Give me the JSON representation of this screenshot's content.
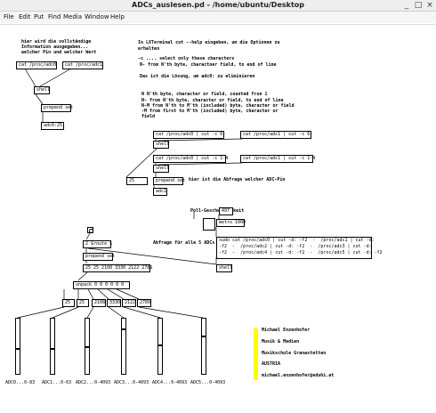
{
  "window": {
    "title": "ADCs_auslesen.pd  - /home/ubuntu/Desktop",
    "minimize": "_",
    "maximize": "□",
    "close": "×"
  },
  "menu": [
    "File",
    "Edit",
    "Put",
    "Find",
    "Media",
    "Window",
    "Help"
  ],
  "comments": {
    "intro": [
      "hier wird die vollständige",
      "Information ausgegeben...",
      "welcher Pin und welcher Wert"
    ],
    "help": [
      "In LXTerminal  cut --help  eingeben, um die Optionen zu",
      "erhalten"
    ],
    "opt1": "-c  .... select only these characters",
    "opt2": "N-    from N'th byte, charactoer field, to end of line",
    "opt3": "Das ist die Lösung, um adc0:  zu eliminieren",
    "opt4": "N     N'th byte, character or field, counted fron 1",
    "opt5": "N-    from N'th byte, character or field, to end of line",
    "opt6": "N-M   from N'th to M'th (included) byte, character or field",
    "opt7": "-M    from first to M'th (included) byte, character or",
    "opt8": "field",
    "pin": "hier ist die Abfrage welcher ADC-Pin",
    "poll": "Poll-Geschwindigkeit",
    "all": "Abfrage für alle 5 ADCs",
    "slider_labels": [
      "ADC0...0-83",
      "ADC1...0-63",
      "ADC2...0-4093",
      "ADC3...0-4093",
      "ADC4...0-4093",
      "ADC5...0-4093"
    ]
  },
  "credits": [
    "Michael Enzenhofer",
    "Musik & Medien",
    "Musikschule Granastetten",
    "AUSTRIA",
    "michael.enzenhofer@eduhi.at"
  ],
  "objects": {
    "cat_adc0": "cat /proc/adc0",
    "cat_adc1": "cat /proc/adc1",
    "shell": "shell",
    "prepend": "prepend set",
    "adc_msg": "adc0:25",
    "cut6_0": "cat /proc/adc0 | cut -c 6-",
    "cut6_1": "cat /proc/adc1 | cut -c 6-",
    "cut14_0": "cat /proc/adc0 | cut -c 1-4",
    "cut14_1": "cat /proc/adc1 | cut -c 1-4",
    "val_25": "25",
    "adc1_msg": "adc1",
    "poll_num": "497",
    "metro": "metro 1000",
    "route": "2 $route_$",
    "big_msg": "sudo cat /proc/adc0 | cut -d: -f2  -  /proc/adc1 | cut -d:\n-f2  -  /proc/adc2 | cut -d: -f2  -  /proc/adc3 | cut -d:\n-f2  -  /proc/adc4 | cut -d: -f2  -  /proc/adc5 | cut -d: -f2",
    "values": "25 25 2108 3330 2122 2789",
    "unpack": "unpack 0 0 0 0 0 0",
    "numbers": [
      "25",
      "25",
      "2108",
      "3330",
      "2122",
      "2789"
    ]
  },
  "sliders": {
    "levels": [
      0.55,
      0.55,
      0.52,
      0.19,
      0.49,
      0.32
    ]
  },
  "colors": {
    "canvas": "#ffffff",
    "credits_bar": "#ffff00"
  }
}
